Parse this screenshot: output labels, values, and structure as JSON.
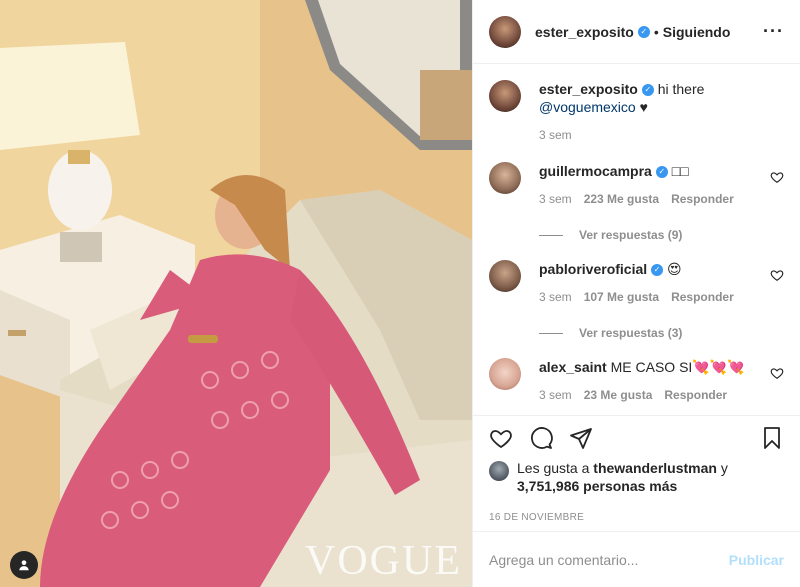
{
  "header": {
    "username": "ester_exposito",
    "separator": "•",
    "follow_status": "Siguiendo",
    "more": "···"
  },
  "caption": {
    "username": "ester_exposito",
    "text": "hi there",
    "mention": "@voguemexico",
    "heart": "♥",
    "time": "3 sem"
  },
  "comments": [
    {
      "username": "guillermocampra",
      "text": "□□",
      "time": "3 sem",
      "likes": "223 Me gusta",
      "reply": "Responder",
      "replies_label": "Ver respuestas (9)"
    },
    {
      "username": "pabloriveroficial",
      "text": "😍",
      "time": "3 sem",
      "likes": "107 Me gusta",
      "reply": "Responder",
      "replies_label": "Ver respuestas (3)"
    },
    {
      "username": "alex_saint",
      "text": "ME CASO SI💘💘💘",
      "time": "3 sem",
      "likes": "23 Me gusta",
      "reply": "Responder"
    }
  ],
  "likes": {
    "prefix": "Les gusta a",
    "user": "thewanderlustman",
    "conj": "y",
    "count": "3,751,986 personas más"
  },
  "date": "16 DE NOVIEMBRE",
  "add_comment": {
    "placeholder": "Agrega un comentario...",
    "publish": "Publicar"
  },
  "photo": {
    "watermark": "VOGUE"
  },
  "colors": {
    "verified": "#3897f0",
    "publish_disabled": "#b2dffc",
    "secondary_text": "#8e8e8e"
  },
  "icons": [
    "heart-icon",
    "comment-icon",
    "share-icon",
    "bookmark-icon",
    "user-tag-icon",
    "more-options-icon",
    "verified-icon"
  ]
}
